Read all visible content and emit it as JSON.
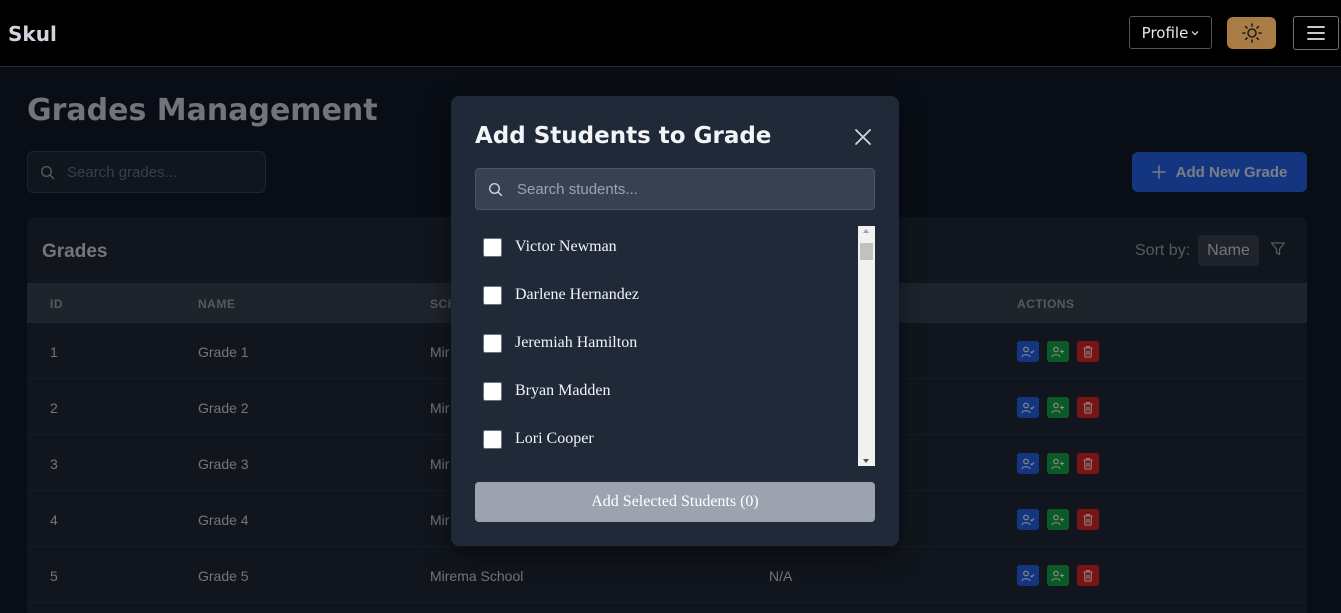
{
  "navbar": {
    "brand": "Skul",
    "profile_label": "Profile",
    "theme_icon": "sun-icon",
    "menu_icon": "hamburger-menu-icon"
  },
  "page": {
    "title": "Grades Management",
    "search_placeholder": "Search grades...",
    "add_grade_label": "Add New Grade"
  },
  "grades": {
    "card_title": "Grades",
    "sort_label": "Sort by:",
    "sort_value": "Name",
    "columns": [
      "ID",
      "NAME",
      "SCH",
      "ACTIONS"
    ],
    "rows": [
      {
        "id": "1",
        "name": "Grade 1",
        "school": "Mir",
        "teacher": ""
      },
      {
        "id": "2",
        "name": "Grade 2",
        "school": "Mir",
        "teacher": ""
      },
      {
        "id": "3",
        "name": "Grade 3",
        "school": "Mir",
        "teacher": ""
      },
      {
        "id": "4",
        "name": "Grade 4",
        "school": "Mir",
        "teacher": ""
      },
      {
        "id": "5",
        "name": "Grade 5",
        "school": "Mirema School",
        "teacher": "N/A"
      }
    ]
  },
  "modal": {
    "title": "Add Students to Grade",
    "search_placeholder": "Search students...",
    "students": [
      {
        "name": "Victor Newman",
        "checked": false
      },
      {
        "name": "Darlene Hernandez",
        "checked": false
      },
      {
        "name": "Jeremiah Hamilton",
        "checked": false
      },
      {
        "name": "Bryan Madden",
        "checked": false
      },
      {
        "name": "Lori Cooper",
        "checked": false
      }
    ],
    "submit_label": "Add Selected Students (0)"
  },
  "colors": {
    "primary": "#2563eb",
    "success": "#16a34a",
    "danger": "#dc2626",
    "theme_toggle": "#a97b45"
  }
}
